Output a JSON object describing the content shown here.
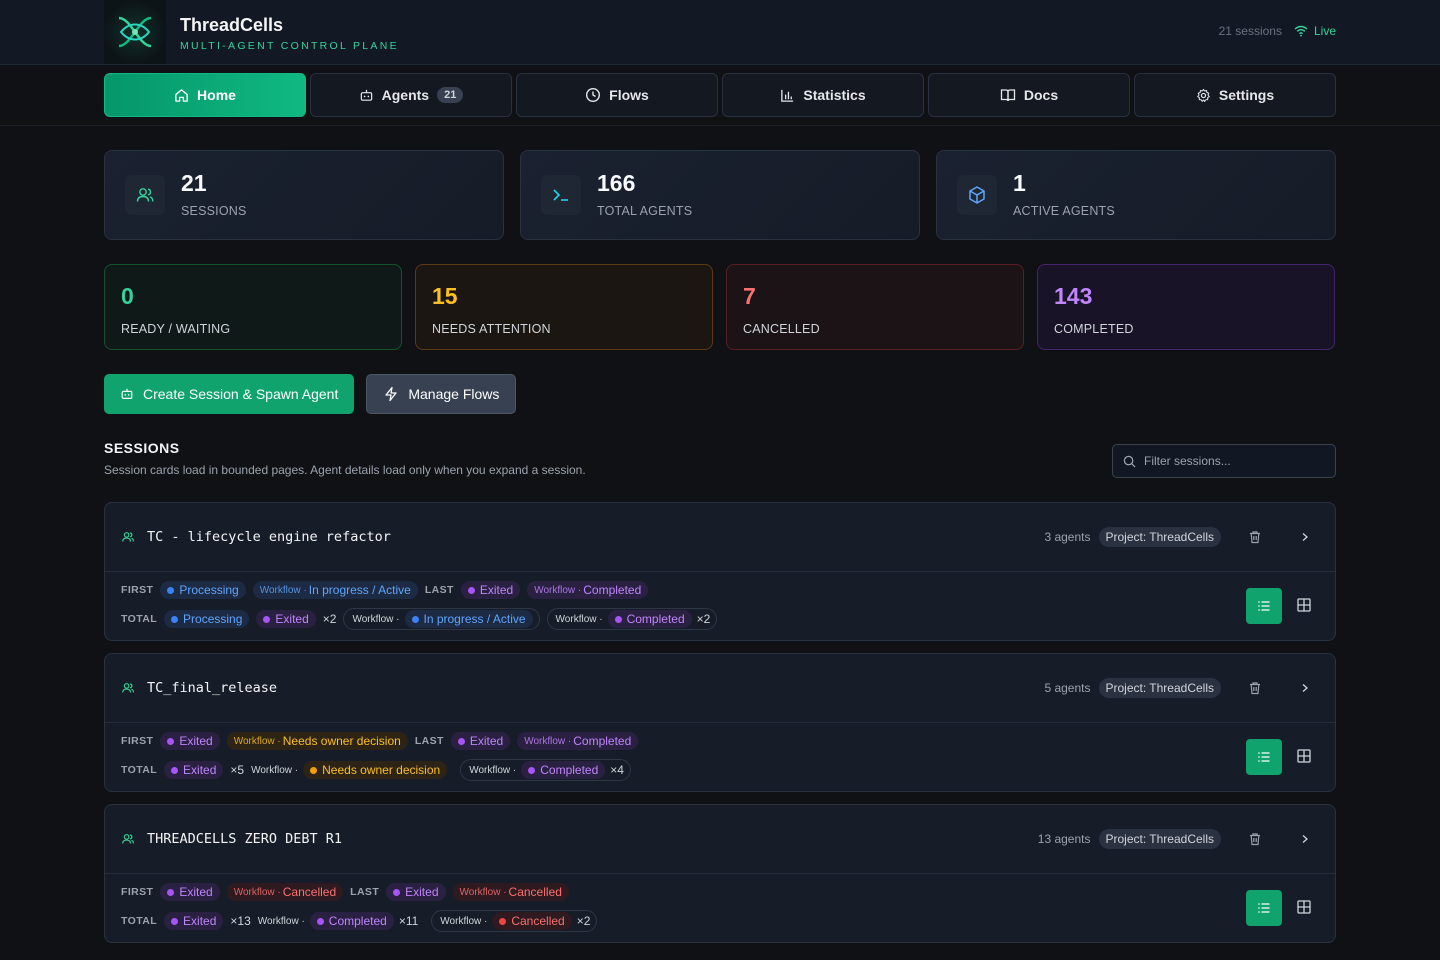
{
  "app": {
    "name": "ThreadCells",
    "subtitle": "MULTI-AGENT CONTROL PLANE",
    "sessions_count": "21 sessions",
    "live_label": "Live"
  },
  "nav": {
    "tabs": [
      {
        "label": "Home",
        "icon": "home-icon",
        "active": true
      },
      {
        "label": "Agents",
        "icon": "robot-icon",
        "badge": "21"
      },
      {
        "label": "Flows",
        "icon": "clock-icon"
      },
      {
        "label": "Statistics",
        "icon": "bar-chart-icon"
      },
      {
        "label": "Docs",
        "icon": "book-icon"
      },
      {
        "label": "Settings",
        "icon": "gear-icon"
      }
    ]
  },
  "stats": {
    "sessions": {
      "value": "21",
      "label": "SESSIONS",
      "icon": "users-icon"
    },
    "total_agents": {
      "value": "166",
      "label": "TOTAL AGENTS",
      "icon": "terminal-icon"
    },
    "active_agents": {
      "value": "1",
      "label": "ACTIVE AGENTS",
      "icon": "cube-icon"
    },
    "ready": {
      "value": "0",
      "label": "READY / WAITING"
    },
    "attention": {
      "value": "15",
      "label": "NEEDS ATTENTION"
    },
    "cancelled": {
      "value": "7",
      "label": "CANCELLED"
    },
    "completed": {
      "value": "143",
      "label": "COMPLETED"
    }
  },
  "actions": {
    "create": "Create Session & Spawn Agent",
    "manage": "Manage Flows"
  },
  "sessions_section": {
    "title": "SESSIONS",
    "description": "Session cards load in bounded pages. Agent details load only when you expand a session.",
    "filter_placeholder": "Filter sessions..."
  },
  "labels": {
    "first": "FIRST",
    "last": "LAST",
    "total": "TOTAL",
    "workflow": "Workflow ·"
  },
  "sessions": [
    {
      "name": "TC - lifecycle engine refactor",
      "agents": "3 agents",
      "project": "Project: ThreadCells",
      "first_status": "Processing",
      "first_workflow": "In progress / Active",
      "last_status": "Exited",
      "last_workflow": "Completed",
      "total": {
        "s1": "Processing",
        "s2": "Exited",
        "s2_mult": "×2",
        "w1": "In progress / Active",
        "w2": "Completed",
        "w2_mult": "×2"
      }
    },
    {
      "name": "TC_final_release",
      "agents": "5 agents",
      "project": "Project: ThreadCells",
      "first_status": "Exited",
      "first_workflow": "Needs owner decision",
      "last_status": "Exited",
      "last_workflow": "Completed",
      "total": {
        "s1": "Exited",
        "s1_mult": "×5",
        "w1": "Needs owner decision",
        "w2": "Completed",
        "w2_mult": "×4"
      }
    },
    {
      "name": "THREADCELLS ZERO DEBT R1",
      "agents": "13 agents",
      "project": "Project: ThreadCells",
      "first_status": "Exited",
      "first_workflow": "Cancelled",
      "last_status": "Exited",
      "last_workflow": "Cancelled",
      "total": {
        "s1": "Exited",
        "s1_mult": "×13",
        "w1": "Completed",
        "w1_mult": "×11",
        "w2": "Cancelled",
        "w2_mult": "×2"
      }
    }
  ],
  "colors": {
    "accent": "#10b981",
    "background": "#0f1115",
    "processing": "#3b82f6",
    "exited": "#a855f7",
    "needs_decision": "#f59e0b",
    "cancelled": "#ef4444"
  }
}
